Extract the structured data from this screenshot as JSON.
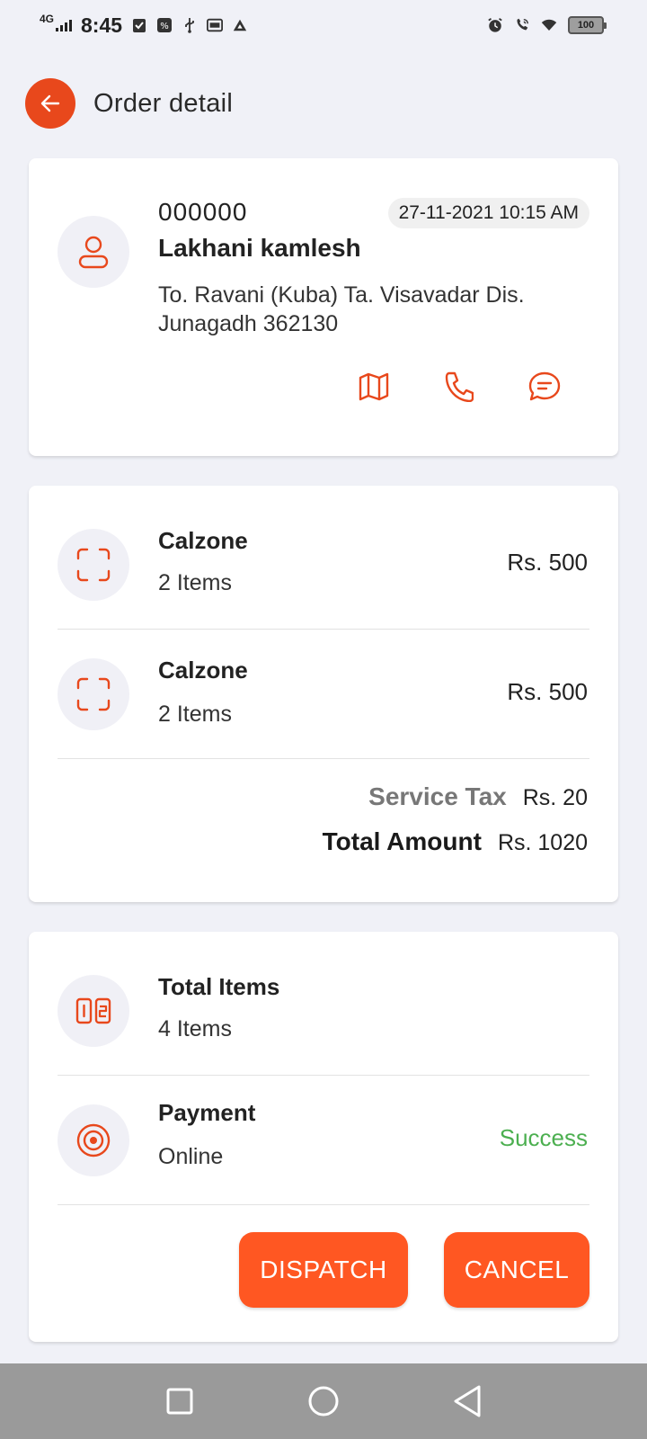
{
  "status_bar": {
    "network": "4G",
    "time": "8:45",
    "battery": "100"
  },
  "header": {
    "title": "Order detail"
  },
  "customer": {
    "order_id": "000000",
    "date": "27-11-2021 10:15 AM",
    "name": "Lakhani kamlesh",
    "address": "To. Ravani (Kuba) Ta. Visavadar Dis. Junagadh 362130"
  },
  "items": [
    {
      "name": "Calzone",
      "quantity": "2 Items",
      "price": "Rs. 500"
    },
    {
      "name": "Calzone",
      "quantity": "2 Items",
      "price": "Rs. 500"
    }
  ],
  "totals": {
    "service_tax_label": "Service Tax",
    "service_tax_value": "Rs. 20",
    "total_label": "Total Amount",
    "total_value": "Rs. 1020"
  },
  "summary": {
    "total_items_label": "Total Items",
    "total_items_value": "4 Items",
    "payment_label": "Payment",
    "payment_method": "Online",
    "payment_status": "Success"
  },
  "actions": {
    "dispatch": "DISPATCH",
    "cancel": "CANCEL"
  },
  "colors": {
    "accent": "#e8481c",
    "button": "#ff5722",
    "success": "#4caf50",
    "background": "#f0f1f7"
  },
  "icons": {
    "back": "arrow-left-icon",
    "user": "user-icon",
    "map": "map-icon",
    "phone": "phone-icon",
    "message": "message-icon",
    "item": "scan-frame-icon",
    "count": "number-box-icon",
    "payment": "target-icon"
  }
}
